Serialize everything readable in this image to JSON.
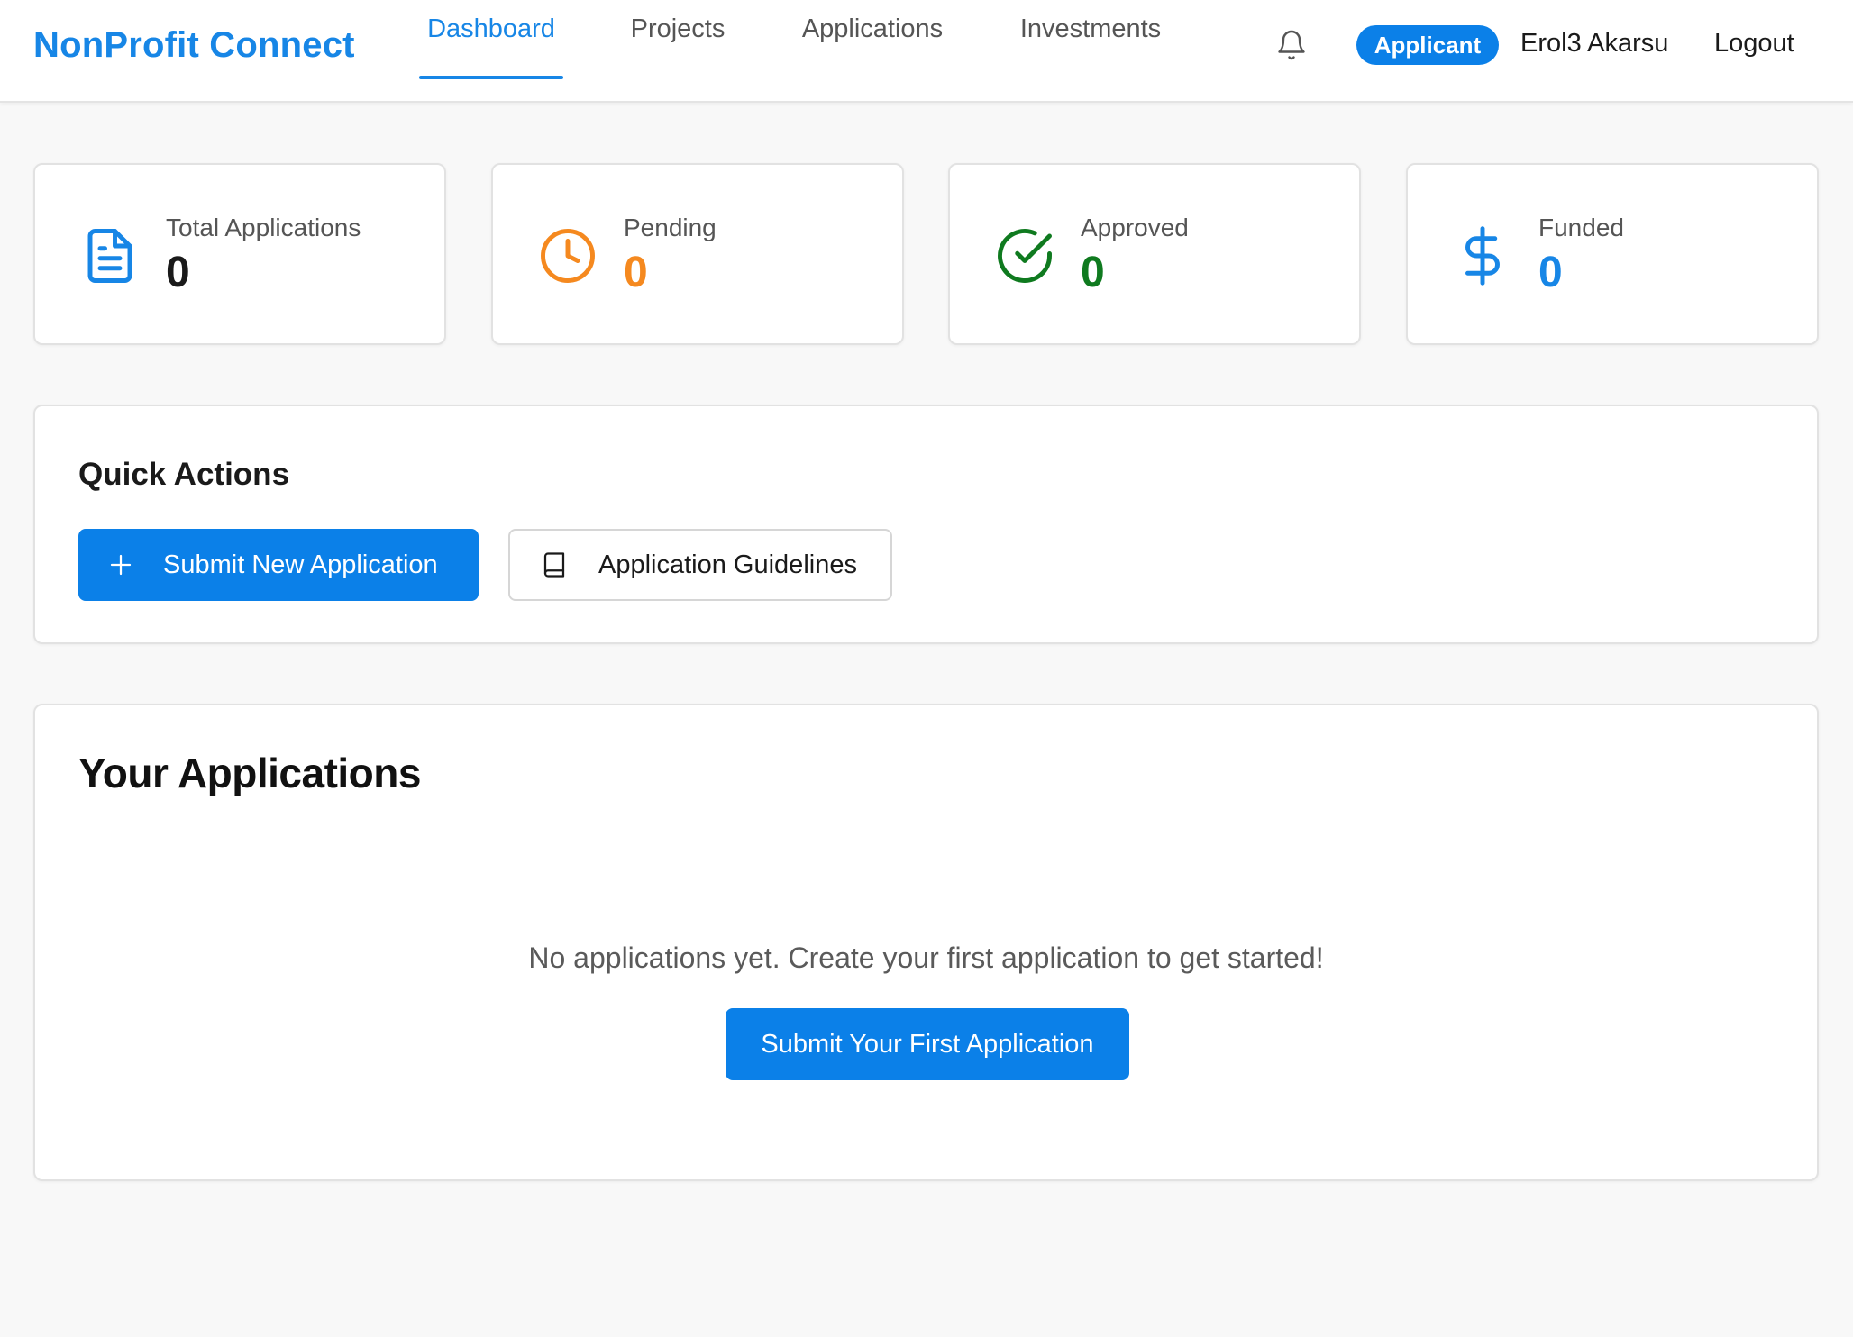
{
  "header": {
    "brand": "NonProfit Connect",
    "nav": [
      {
        "label": "Dashboard",
        "active": true
      },
      {
        "label": "Projects",
        "active": false
      },
      {
        "label": "Applications",
        "active": false
      },
      {
        "label": "Investments",
        "active": false
      }
    ],
    "notifications_icon": "bell-icon",
    "role_badge": "Applicant",
    "user_name": "Erol3 Akarsu",
    "logout_label": "Logout"
  },
  "stats": [
    {
      "label": "Total Applications",
      "value": "0",
      "icon": "document-icon",
      "color": "#1a1a1a",
      "icon_color": "#1786e6"
    },
    {
      "label": "Pending",
      "value": "0",
      "icon": "clock-icon",
      "color": "#f5891f",
      "icon_color": "#f5891f"
    },
    {
      "label": "Approved",
      "value": "0",
      "icon": "check-circle-icon",
      "color": "#0f7a1f",
      "icon_color": "#0f7a1f"
    },
    {
      "label": "Funded",
      "value": "0",
      "icon": "dollar-icon",
      "color": "#1786e6",
      "icon_color": "#1786e6"
    }
  ],
  "quick_actions": {
    "title": "Quick Actions",
    "submit_label": "Submit New Application",
    "submit_icon": "plus-icon",
    "guidelines_label": "Application Guidelines",
    "guidelines_icon": "book-icon"
  },
  "applications": {
    "title": "Your Applications",
    "empty_message": "No applications yet. Create your first application to get started!",
    "first_app_label": "Submit Your First Application"
  },
  "colors": {
    "accent": "#0b80e8",
    "brand": "#1786e6",
    "pending": "#f5891f",
    "approved": "#0f7a1f"
  }
}
